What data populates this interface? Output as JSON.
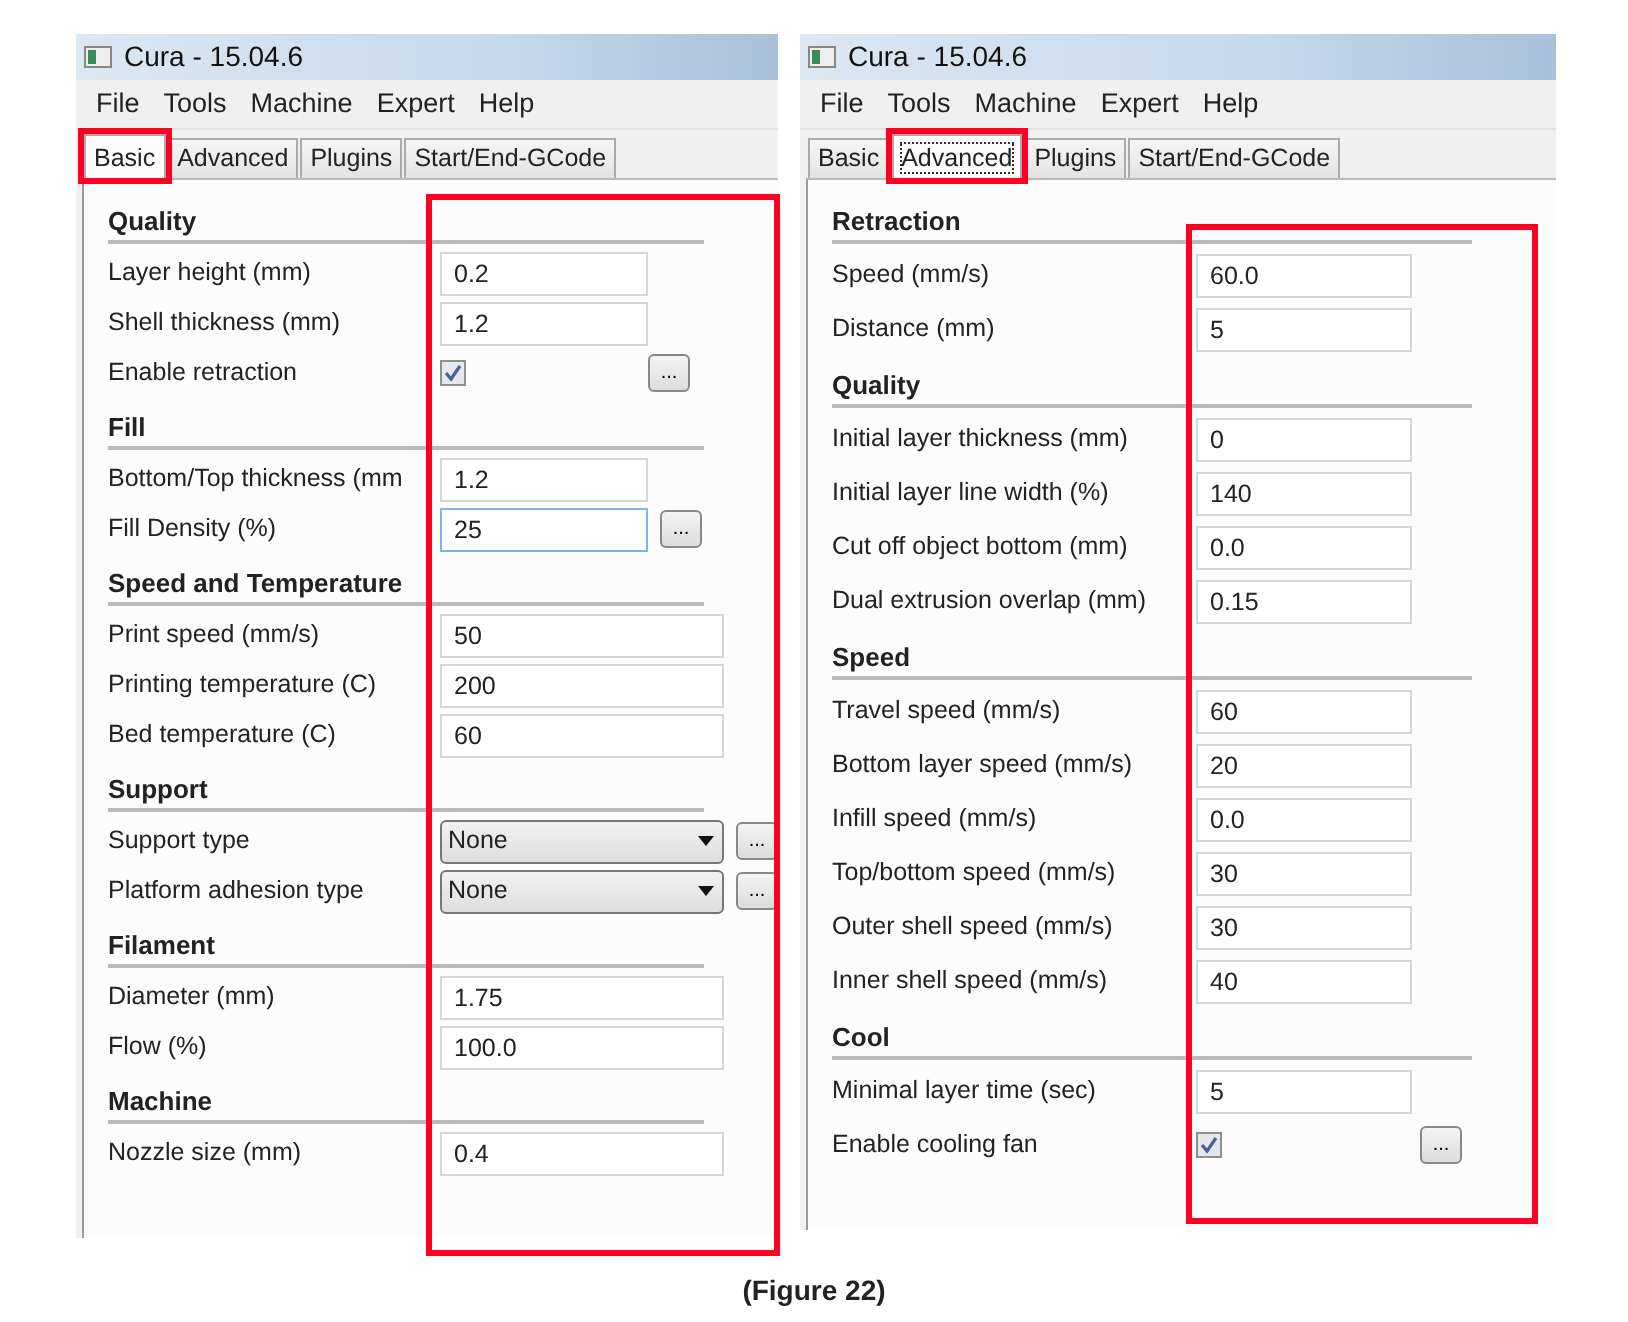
{
  "windows": [
    {
      "title": "Cura - 15.04.6",
      "menu": [
        "File",
        "Tools",
        "Machine",
        "Expert",
        "Help"
      ],
      "tabs": [
        {
          "label": "Basic",
          "selected": true,
          "highlighted": true
        },
        {
          "label": "Advanced",
          "selected": false,
          "highlighted": false
        },
        {
          "label": "Plugins",
          "selected": false,
          "highlighted": false
        },
        {
          "label": "Start/End-GCode",
          "selected": false,
          "highlighted": false
        }
      ],
      "values_highlighted": true,
      "sections": [
        {
          "title": "Quality",
          "rows": [
            {
              "kind": "text",
              "label": "Layer height (mm)",
              "value": "0.2",
              "focused": false
            },
            {
              "kind": "text",
              "label": "Shell thickness (mm)",
              "value": "1.2",
              "focused": false
            },
            {
              "kind": "checkbox",
              "label": "Enable retraction",
              "checked": true,
              "more": "..."
            }
          ]
        },
        {
          "title": "Fill",
          "rows": [
            {
              "kind": "text",
              "label": "Bottom/Top thickness (mm",
              "value": "1.2",
              "focused": false
            },
            {
              "kind": "text",
              "label": "Fill Density (%)",
              "value": "25",
              "focused": true,
              "more": "..."
            }
          ]
        },
        {
          "title": "Speed and Temperature",
          "rows": [
            {
              "kind": "text",
              "label": "Print speed (mm/s)",
              "value": "50",
              "focused": false
            },
            {
              "kind": "text",
              "label": "Printing temperature (C)",
              "value": "200",
              "focused": false
            },
            {
              "kind": "text",
              "label": "Bed temperature (C)",
              "value": "60",
              "focused": false
            }
          ]
        },
        {
          "title": "Support",
          "rows": [
            {
              "kind": "select",
              "label": "Support type",
              "value": "None",
              "more": "..."
            },
            {
              "kind": "select",
              "label": "Platform adhesion type",
              "value": "None",
              "more": "..."
            }
          ]
        },
        {
          "title": "Filament",
          "rows": [
            {
              "kind": "text",
              "label": "Diameter (mm)",
              "value": "1.75",
              "focused": false
            },
            {
              "kind": "text",
              "label": "Flow (%)",
              "value": "100.0",
              "focused": false
            }
          ]
        },
        {
          "title": "Machine",
          "rows": [
            {
              "kind": "text",
              "label": "Nozzle size (mm)",
              "value": "0.4",
              "focused": false
            }
          ]
        }
      ]
    },
    {
      "title": "Cura - 15.04.6",
      "menu": [
        "File",
        "Tools",
        "Machine",
        "Expert",
        "Help"
      ],
      "tabs": [
        {
          "label": "Basic",
          "selected": false,
          "highlighted": false
        },
        {
          "label": "Advanced",
          "selected": true,
          "highlighted": true
        },
        {
          "label": "Plugins",
          "selected": false,
          "highlighted": false
        },
        {
          "label": "Start/End-GCode",
          "selected": false,
          "highlighted": false
        }
      ],
      "values_highlighted": true,
      "sections": [
        {
          "title": "Retraction",
          "rows": [
            {
              "kind": "text",
              "label": "Speed (mm/s)",
              "value": "60.0",
              "focused": false
            },
            {
              "kind": "text",
              "label": "Distance (mm)",
              "value": "5",
              "focused": false
            }
          ]
        },
        {
          "title": "Quality",
          "rows": [
            {
              "kind": "text",
              "label": "Initial layer thickness (mm)",
              "value": "0",
              "focused": false
            },
            {
              "kind": "text",
              "label": "Initial layer line width (%)",
              "value": "140",
              "focused": false
            },
            {
              "kind": "text",
              "label": "Cut off object bottom (mm)",
              "value": "0.0",
              "focused": false
            },
            {
              "kind": "text",
              "label": "Dual extrusion overlap (mm)",
              "value": "0.15",
              "focused": false
            }
          ]
        },
        {
          "title": "Speed",
          "rows": [
            {
              "kind": "text",
              "label": "Travel speed (mm/s)",
              "value": "60",
              "focused": false
            },
            {
              "kind": "text",
              "label": "Bottom layer speed (mm/s)",
              "value": "20",
              "focused": false
            },
            {
              "kind": "text",
              "label": "Infill speed (mm/s)",
              "value": "0.0",
              "focused": false
            },
            {
              "kind": "text",
              "label": "Top/bottom speed (mm/s)",
              "value": "30",
              "focused": false
            },
            {
              "kind": "text",
              "label": "Outer shell speed (mm/s)",
              "value": "30",
              "focused": false
            },
            {
              "kind": "text",
              "label": "Inner shell speed (mm/s)",
              "value": "40",
              "focused": false
            }
          ]
        },
        {
          "title": "Cool",
          "rows": [
            {
              "kind": "text",
              "label": "Minimal layer time (sec)",
              "value": "5",
              "focused": false
            },
            {
              "kind": "checkbox",
              "label": "Enable cooling fan",
              "checked": true,
              "more": "..."
            }
          ]
        }
      ]
    }
  ],
  "caption": "(Figure 22)"
}
